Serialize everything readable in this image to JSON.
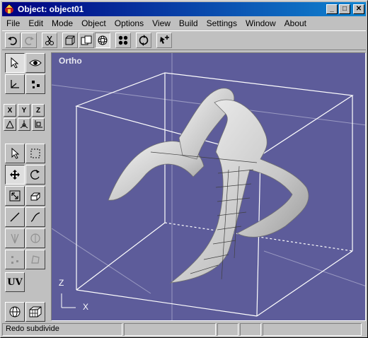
{
  "window": {
    "title": "Object: object01",
    "minimize": "_",
    "maximize": "□",
    "close": "✕"
  },
  "menu": [
    "File",
    "Edit",
    "Mode",
    "Object",
    "Options",
    "View",
    "Build",
    "Settings",
    "Window",
    "About"
  ],
  "viewport": {
    "label": "Ortho",
    "axis_z": "Z",
    "axis_x": "X",
    "background": "#5d5c9a"
  },
  "palette": {
    "x": "X",
    "y": "Y",
    "z": "Z",
    "uv": "UV"
  },
  "status": {
    "message": "Redo subdivide",
    "pane2": "",
    "pane3": "",
    "pane4": "",
    "pane5": ""
  }
}
